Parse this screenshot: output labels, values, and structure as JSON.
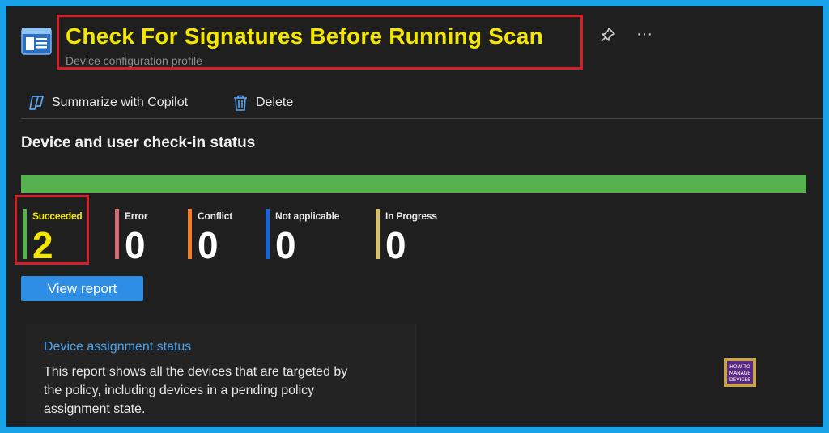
{
  "header": {
    "title": "Check For Signatures Before Running Scan",
    "subtitle": "Device configuration profile",
    "pin_icon": "pin-icon",
    "more_icon": "more-icon",
    "more_label": "···"
  },
  "toolbar": {
    "summarize_label": "Summarize with Copilot",
    "delete_label": "Delete"
  },
  "status": {
    "title": "Device and user check-in status",
    "progress_fraction": 1.0,
    "progress_color": "#58b14f",
    "items": [
      {
        "label": "Succeeded",
        "value": "2",
        "color": "#58b14f"
      },
      {
        "label": "Error",
        "value": "0",
        "color": "#d66b73"
      },
      {
        "label": "Conflict",
        "value": "0",
        "color": "#f07e2a"
      },
      {
        "label": "Not applicable",
        "value": "0",
        "color": "#1565d8"
      },
      {
        "label": "In Progress",
        "value": "0",
        "color": "#d8c068"
      }
    ],
    "view_report_label": "View report"
  },
  "card": {
    "title": "Device assignment status",
    "description": "This report shows all the devices that are targeted by the policy, including devices in a pending policy assignment state."
  },
  "logo": {
    "text_top": "HOW TO",
    "text_mid": "MANAGE",
    "text_bot": "DEVICES"
  }
}
